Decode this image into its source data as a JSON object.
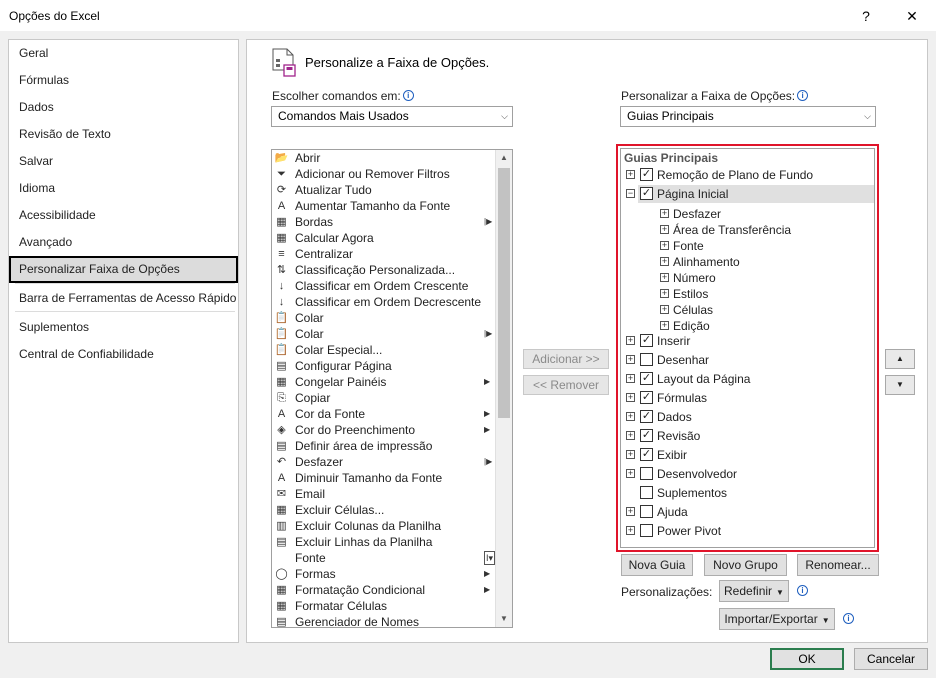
{
  "window": {
    "title": "Opções do Excel",
    "help": "?",
    "close": "✕"
  },
  "nav": {
    "items": [
      {
        "label": "Geral"
      },
      {
        "label": "Fórmulas"
      },
      {
        "label": "Dados"
      },
      {
        "label": "Revisão de Texto"
      },
      {
        "label": "Salvar"
      },
      {
        "label": "Idioma"
      },
      {
        "label": "Acessibilidade"
      },
      {
        "label": "Avançado"
      },
      {
        "label": "Personalizar Faixa de Opções",
        "selected": true
      },
      {
        "label": "Barra de Ferramentas de Acesso Rápido"
      },
      {
        "label": "Suplementos"
      },
      {
        "label": "Central de Confiabilidade"
      }
    ]
  },
  "main": {
    "title": "Personalize a Faixa de Opções.",
    "choose_label": "Escolher comandos em:",
    "choose_value": "Comandos Mais Usados",
    "customize_label": "Personalizar a Faixa de Opções:",
    "customize_value": "Guias Principais",
    "commands": [
      {
        "label": "Abrir",
        "icon": "folder-icon",
        "glyph": "📂",
        "submenu": false
      },
      {
        "label": "Adicionar ou Remover Filtros",
        "icon": "filter-icon",
        "glyph": "⏷",
        "submenu": false
      },
      {
        "label": "Atualizar Tudo",
        "icon": "refresh-icon",
        "glyph": "⟳",
        "submenu": false
      },
      {
        "label": "Aumentar Tamanho da Fonte",
        "icon": "font-grow-icon",
        "glyph": "A",
        "submenu": false
      },
      {
        "label": "Bordas",
        "icon": "borders-icon",
        "glyph": "▦",
        "submenu": true,
        "submenu_style": "split"
      },
      {
        "label": "Calcular Agora",
        "icon": "calculator-icon",
        "glyph": "▦",
        "submenu": false
      },
      {
        "label": "Centralizar",
        "icon": "align-center-icon",
        "glyph": "≡",
        "submenu": false
      },
      {
        "label": "Classificação Personalizada...",
        "icon": "sort-custom-icon",
        "glyph": "⇅",
        "submenu": false
      },
      {
        "label": "Classificar em Ordem Crescente",
        "icon": "sort-ascending-icon",
        "glyph": "↓",
        "submenu": false
      },
      {
        "label": "Classificar em Ordem Decrescente",
        "icon": "sort-descending-icon",
        "glyph": "↓",
        "submenu": false
      },
      {
        "label": "Colar",
        "icon": "paste-icon",
        "glyph": "📋",
        "submenu": false
      },
      {
        "label": "Colar",
        "icon": "paste-options-icon",
        "glyph": "📋",
        "submenu": true,
        "submenu_style": "split"
      },
      {
        "label": "Colar Especial...",
        "icon": "paste-special-icon",
        "glyph": "📋",
        "submenu": false
      },
      {
        "label": "Configurar Página",
        "icon": "page-setup-icon",
        "glyph": "▤",
        "submenu": false
      },
      {
        "label": "Congelar Painéis",
        "icon": "freeze-panes-icon",
        "glyph": "▦",
        "submenu": true,
        "submenu_style": "plain"
      },
      {
        "label": "Copiar",
        "icon": "copy-icon",
        "glyph": "⎘",
        "submenu": false
      },
      {
        "label": "Cor da Fonte",
        "icon": "font-color-icon",
        "glyph": "A",
        "submenu": true,
        "submenu_style": "plain"
      },
      {
        "label": "Cor do Preenchimento",
        "icon": "fill-color-icon",
        "glyph": "◈",
        "submenu": true,
        "submenu_style": "plain"
      },
      {
        "label": "Definir área de impressão",
        "icon": "print-area-icon",
        "glyph": "▤",
        "submenu": false
      },
      {
        "label": "Desfazer",
        "icon": "undo-icon",
        "glyph": "↶",
        "submenu": true,
        "submenu_style": "split"
      },
      {
        "label": "Diminuir Tamanho da Fonte",
        "icon": "font-shrink-icon",
        "glyph": "A",
        "submenu": false
      },
      {
        "label": "Email",
        "icon": "email-icon",
        "glyph": "✉",
        "submenu": false
      },
      {
        "label": "Excluir Células...",
        "icon": "delete-cells-icon",
        "glyph": "▦",
        "submenu": false
      },
      {
        "label": "Excluir Colunas da Planilha",
        "icon": "delete-columns-icon",
        "glyph": "▥",
        "submenu": false
      },
      {
        "label": "Excluir Linhas da Planilha",
        "icon": "delete-rows-icon",
        "glyph": "▤",
        "submenu": false
      },
      {
        "label": "Fonte",
        "icon": "font-icon",
        "glyph": "",
        "submenu": true,
        "submenu_style": "font-box"
      },
      {
        "label": "Formas",
        "icon": "shapes-icon",
        "glyph": "◯",
        "submenu": true,
        "submenu_style": "plain"
      },
      {
        "label": "Formatação Condicional",
        "icon": "conditional-format-icon",
        "glyph": "▦",
        "submenu": true,
        "submenu_style": "plain"
      },
      {
        "label": "Formatar Células",
        "icon": "format-cells-icon",
        "glyph": "▦",
        "submenu": false
      },
      {
        "label": "Gerenciador de Nomes",
        "icon": "name-manager-icon",
        "glyph": "▤",
        "submenu": false
      }
    ],
    "add_button": "Adicionar >>",
    "remove_button": "<< Remover",
    "tree": {
      "header": "Guias Principais",
      "items": [
        {
          "label": "Remoção de Plano de Fundo",
          "level": 0,
          "expander": "+",
          "checkbox": true,
          "checked": true
        },
        {
          "label": "Página Inicial",
          "level": 0,
          "expander": "−",
          "checkbox": true,
          "checked": true,
          "highlighted": true
        },
        {
          "label": "Desfazer",
          "level": 1,
          "expander": "+",
          "checkbox": false
        },
        {
          "label": "Área de Transferência",
          "level": 1,
          "expander": "+",
          "checkbox": false
        },
        {
          "label": "Fonte",
          "level": 1,
          "expander": "+",
          "checkbox": false
        },
        {
          "label": "Alinhamento",
          "level": 1,
          "expander": "+",
          "checkbox": false
        },
        {
          "label": "Número",
          "level": 1,
          "expander": "+",
          "checkbox": false
        },
        {
          "label": "Estilos",
          "level": 1,
          "expander": "+",
          "checkbox": false
        },
        {
          "label": "Células",
          "level": 1,
          "expander": "+",
          "checkbox": false
        },
        {
          "label": "Edição",
          "level": 1,
          "expander": "+",
          "checkbox": false
        },
        {
          "label": "Inserir",
          "level": 0,
          "expander": "+",
          "checkbox": true,
          "checked": true
        },
        {
          "label": "Desenhar",
          "level": 0,
          "expander": "+",
          "checkbox": true,
          "checked": false
        },
        {
          "label": "Layout da Página",
          "level": 0,
          "expander": "+",
          "checkbox": true,
          "checked": true
        },
        {
          "label": "Fórmulas",
          "level": 0,
          "expander": "+",
          "checkbox": true,
          "checked": true
        },
        {
          "label": "Dados",
          "level": 0,
          "expander": "+",
          "checkbox": true,
          "checked": true
        },
        {
          "label": "Revisão",
          "level": 0,
          "expander": "+",
          "checkbox": true,
          "checked": true
        },
        {
          "label": "Exibir",
          "level": 0,
          "expander": "+",
          "checkbox": true,
          "checked": true
        },
        {
          "label": "Desenvolvedor",
          "level": 0,
          "expander": "+",
          "checkbox": true,
          "checked": false
        },
        {
          "label": "Suplementos",
          "level": 0,
          "expander": "",
          "checkbox": true,
          "checked": false
        },
        {
          "label": "Ajuda",
          "level": 0,
          "expander": "+",
          "checkbox": true,
          "checked": false
        },
        {
          "label": "Power Pivot",
          "level": 0,
          "expander": "+",
          "checkbox": true,
          "checked": false
        }
      ]
    },
    "move_up": "▲",
    "move_down": "▼",
    "new_tab": "Nova Guia",
    "new_group": "Novo Grupo",
    "rename": "Renomear...",
    "customizations_label": "Personalizações:",
    "reset": "Redefinir",
    "import_export": "Importar/Exportar"
  },
  "footer": {
    "ok": "OK",
    "cancel": "Cancelar"
  },
  "colors": {
    "highlight_border": "#e0142a",
    "ok_border": "#2b7d4e",
    "selected_nav_bg": "#dcdcdc"
  }
}
